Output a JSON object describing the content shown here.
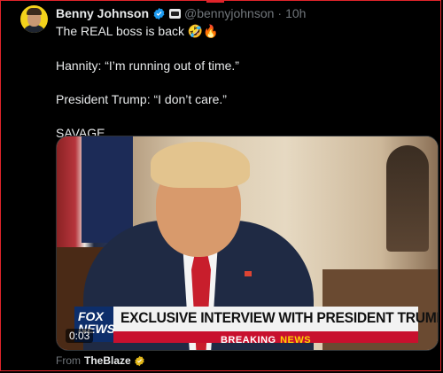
{
  "tweet": {
    "author_name": "Benny Johnson",
    "author_handle": "@bennyjohnson",
    "separator": "·",
    "time_ago": "10h",
    "lines": [
      "The REAL boss is back",
      "",
      "Hannity: “I’m running out of time.”",
      "",
      "President Trump: “I don’t care.”",
      "",
      "SAVAGE."
    ],
    "emojis": "🤣🔥"
  },
  "video": {
    "timestamp": "0:03",
    "network_logo": "FOX NEWS",
    "headline": "EXCLUSIVE INTERVIEW WITH PRESIDENT TRUMP",
    "ticker_breaking": "BREAKING",
    "ticker_news": "NEWS"
  },
  "source": {
    "prefix": "From",
    "name": "TheBlaze"
  },
  "colors": {
    "background": "#000000",
    "text_primary": "#e7e9ea",
    "text_secondary": "#71767b",
    "verified_blue": "#1d9bf0",
    "verified_gold": "#e2b719",
    "ticker_red": "#c8102e",
    "frame_red": "#e0242b"
  },
  "icons": {
    "verified": "verified-badge-icon",
    "affiliation": "affiliation-badge-icon",
    "gold_check": "gold-check-icon"
  }
}
